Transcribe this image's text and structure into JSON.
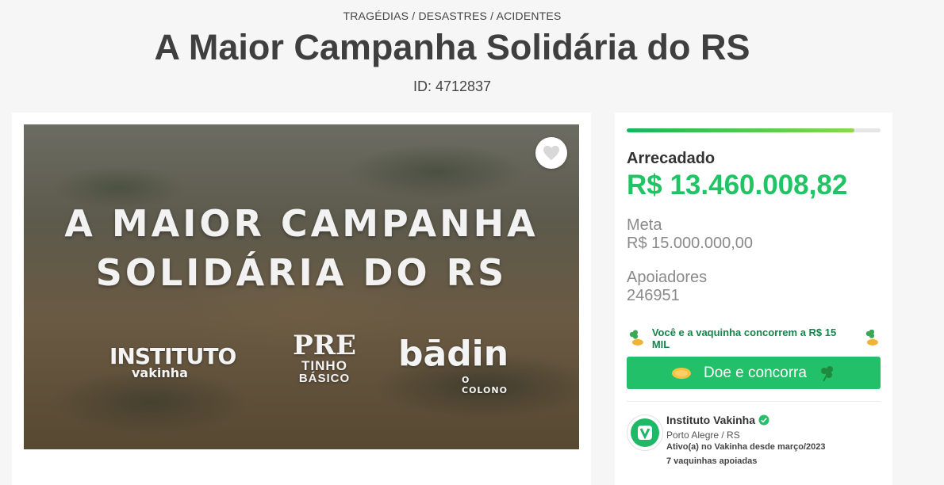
{
  "header": {
    "category": "TRAGÉDIAS / DESASTRES / ACIDENTES",
    "title": "A Maior Campanha Solidária do RS",
    "id_label": "ID: 4712837"
  },
  "hero": {
    "line1": "A MAIOR CAMPANHA",
    "line2": "SOLIDÁRIA DO RS",
    "logo_instituto": "INSTITUTO",
    "logo_instituto_sub": "vakinha",
    "logo_pretinho_a": "PRE",
    "logo_pretinho_b": "TINHO",
    "logo_pretinho_c": "BÁSICO",
    "logo_badin": "bādin",
    "logo_badin_sub": "O COLONO"
  },
  "stats": {
    "progress_fraction": 0.897,
    "raised_label": "Arrecadado",
    "raised_value": "R$ 13.460.008,82",
    "goal_label": "Meta",
    "goal_value": "R$ 15.000.000,00",
    "supporters_label": "Apoiadores",
    "supporters_value": "246951",
    "promo_text": "Você e a vaquinha concorrem a R$ 15 MIL",
    "cta_label": "Doe e concorra"
  },
  "owner": {
    "name": "Instituto Vakinha",
    "location": "Porto Alegre /  RS",
    "since": "Ativo(a) no Vakinha desde março/2023",
    "count": "7 vaquinhas apoiadas"
  },
  "colors": {
    "accent": "#23c06a",
    "raised": "#20c465",
    "promo": "#11854a"
  }
}
